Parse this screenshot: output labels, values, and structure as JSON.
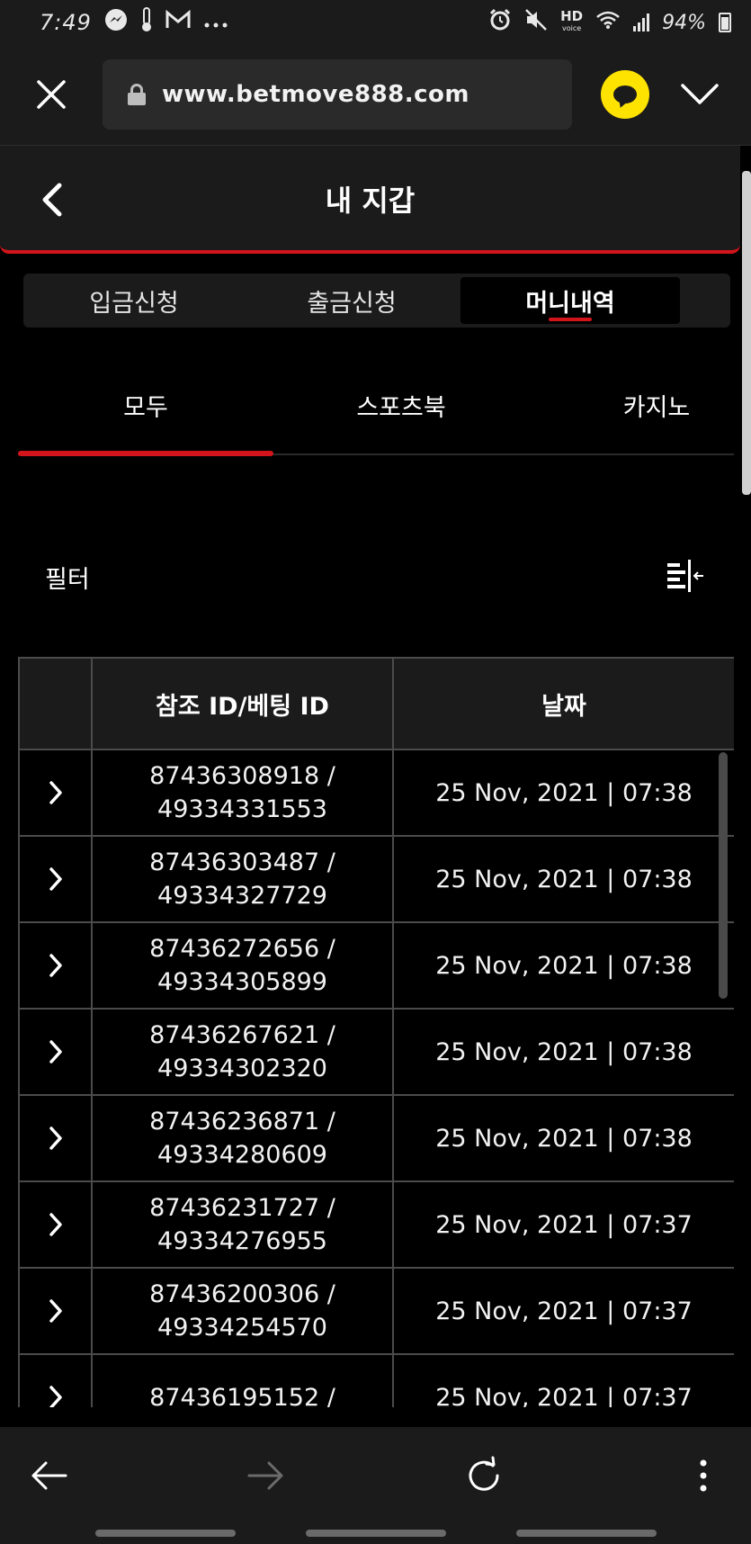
{
  "status_bar": {
    "time": "7:49",
    "battery": "94%"
  },
  "browser": {
    "url": "www.betmove888.com"
  },
  "header": {
    "title": "내 지갑"
  },
  "segment_tabs": [
    {
      "label": "입금신청",
      "active": false
    },
    {
      "label": "출금신청",
      "active": false
    },
    {
      "label": "머니내역",
      "active": true
    }
  ],
  "category_tabs": [
    {
      "label": "모두",
      "active": true
    },
    {
      "label": "스포츠북",
      "active": false
    },
    {
      "label": "카지노",
      "active": false
    }
  ],
  "filter": {
    "label": "필터"
  },
  "table": {
    "columns": [
      "",
      "참조 ID/베팅 ID",
      "날짜"
    ],
    "rows": [
      {
        "ref_id": "87436308918 /",
        "bet_id": "49334331553",
        "date": "25 Nov, 2021 | 07:38"
      },
      {
        "ref_id": "87436303487 /",
        "bet_id": "49334327729",
        "date": "25 Nov, 2021 | 07:38"
      },
      {
        "ref_id": "87436272656 /",
        "bet_id": "49334305899",
        "date": "25 Nov, 2021 | 07:38"
      },
      {
        "ref_id": "87436267621 /",
        "bet_id": "49334302320",
        "date": "25 Nov, 2021 | 07:38"
      },
      {
        "ref_id": "87436236871 /",
        "bet_id": "49334280609",
        "date": "25 Nov, 2021 | 07:38"
      },
      {
        "ref_id": "87436231727 /",
        "bet_id": "49334276955",
        "date": "25 Nov, 2021 | 07:37"
      },
      {
        "ref_id": "87436200306 /",
        "bet_id": "49334254570",
        "date": "25 Nov, 2021 | 07:37"
      },
      {
        "ref_id": "87436195152 /",
        "bet_id": "",
        "date": "25 Nov, 2021 | 07:37"
      }
    ]
  },
  "colors": {
    "accent": "#d3151b",
    "background": "#000000",
    "panel": "#1b1b1b",
    "border": "#4b4b4b",
    "kakao": "#ffe300"
  }
}
